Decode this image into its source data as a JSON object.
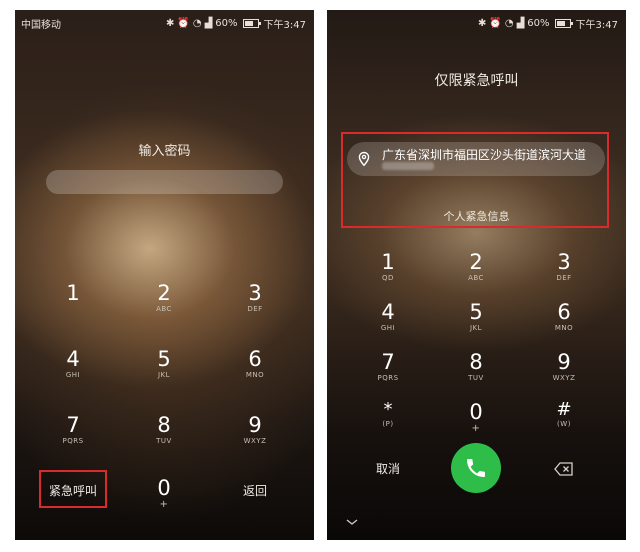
{
  "screen1": {
    "status": {
      "carrier": "中国移动",
      "battery": "60%",
      "time": "下午3:47"
    },
    "title": "输入密码",
    "keys": [
      {
        "digit": "1",
        "letters": ""
      },
      {
        "digit": "2",
        "letters": "ABC"
      },
      {
        "digit": "3",
        "letters": "DEF"
      },
      {
        "digit": "4",
        "letters": "GHI"
      },
      {
        "digit": "5",
        "letters": "JKL"
      },
      {
        "digit": "6",
        "letters": "MNO"
      },
      {
        "digit": "7",
        "letters": "PQRS"
      },
      {
        "digit": "8",
        "letters": "TUV"
      },
      {
        "digit": "9",
        "letters": "WXYZ"
      },
      {
        "digit": "0",
        "letters": "+"
      }
    ],
    "emergency_label": "紧急呼叫",
    "back_label": "返回"
  },
  "screen2": {
    "status": {
      "battery": "60%",
      "time": "下午3:47"
    },
    "title": "仅限紧急呼叫",
    "address": "广东省深圳市福田区沙头街道滨河大道",
    "personal_info": "个人紧急信息",
    "keys": [
      {
        "digit": "1",
        "letters": "QD"
      },
      {
        "digit": "2",
        "letters": "ABC"
      },
      {
        "digit": "3",
        "letters": "DEF"
      },
      {
        "digit": "4",
        "letters": "GHI"
      },
      {
        "digit": "5",
        "letters": "JKL"
      },
      {
        "digit": "6",
        "letters": "MNO"
      },
      {
        "digit": "7",
        "letters": "PQRS"
      },
      {
        "digit": "8",
        "letters": "TUV"
      },
      {
        "digit": "9",
        "letters": "WXYZ"
      },
      {
        "digit": "*",
        "letters": "(P)"
      },
      {
        "digit": "0",
        "letters": "+"
      },
      {
        "digit": "#",
        "letters": "(W)"
      }
    ],
    "cancel_label": "取消"
  },
  "colors": {
    "call_green": "#2fbd4a",
    "highlight_red": "#d92b2b"
  }
}
